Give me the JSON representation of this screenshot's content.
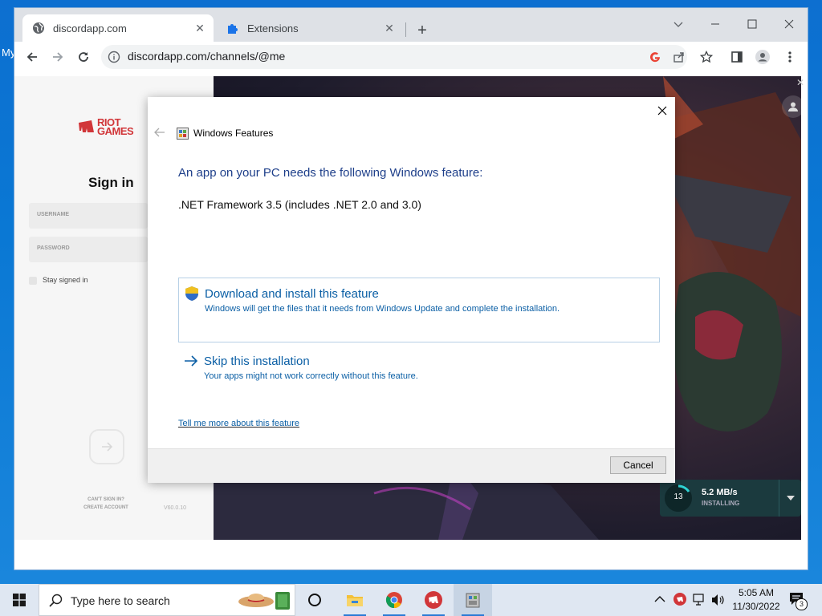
{
  "desktop": {
    "label": "My"
  },
  "browser": {
    "tabs": [
      {
        "label": "discordapp.com"
      },
      {
        "label": "Extensions"
      }
    ],
    "new_tab": "+",
    "url": "discordapp.com/channels/@me"
  },
  "riot": {
    "logo_line1": "RIOT",
    "logo_line2": "GAMES",
    "sign_in_title": "Sign in",
    "username_placeholder": "USERNAME",
    "password_placeholder": "PASSWORD",
    "stay_signed_in": "Stay signed in",
    "cant_sign_in": "CAN'T SIGN IN?",
    "create_account": "CREATE ACCOUNT",
    "version": "V60.0.10",
    "download": {
      "speed": "5.2 MB/s",
      "status": "INSTALLING",
      "count": "13"
    }
  },
  "dialog": {
    "title": "Windows Features",
    "heading": "An app on your PC needs the following Windows feature:",
    "feature": ".NET Framework 3.5 (includes .NET 2.0 and 3.0)",
    "option1_title": "Download and install this feature",
    "option1_desc": "Windows will get the files that it needs from Windows Update and complete the installation.",
    "option2_title": "Skip this installation",
    "option2_desc": "Your apps might not work correctly without this feature.",
    "more_link": "Tell me more about this feature",
    "cancel": "Cancel"
  },
  "taskbar": {
    "search_placeholder": "Type here to search",
    "time": "5:05 AM",
    "date": "11/30/2022",
    "notification_count": "3"
  },
  "colors": {
    "accent": "#0a78d4",
    "riot_red": "#d13639",
    "link": "#0b5fa5",
    "dialog_heading": "#1e3f8a"
  }
}
